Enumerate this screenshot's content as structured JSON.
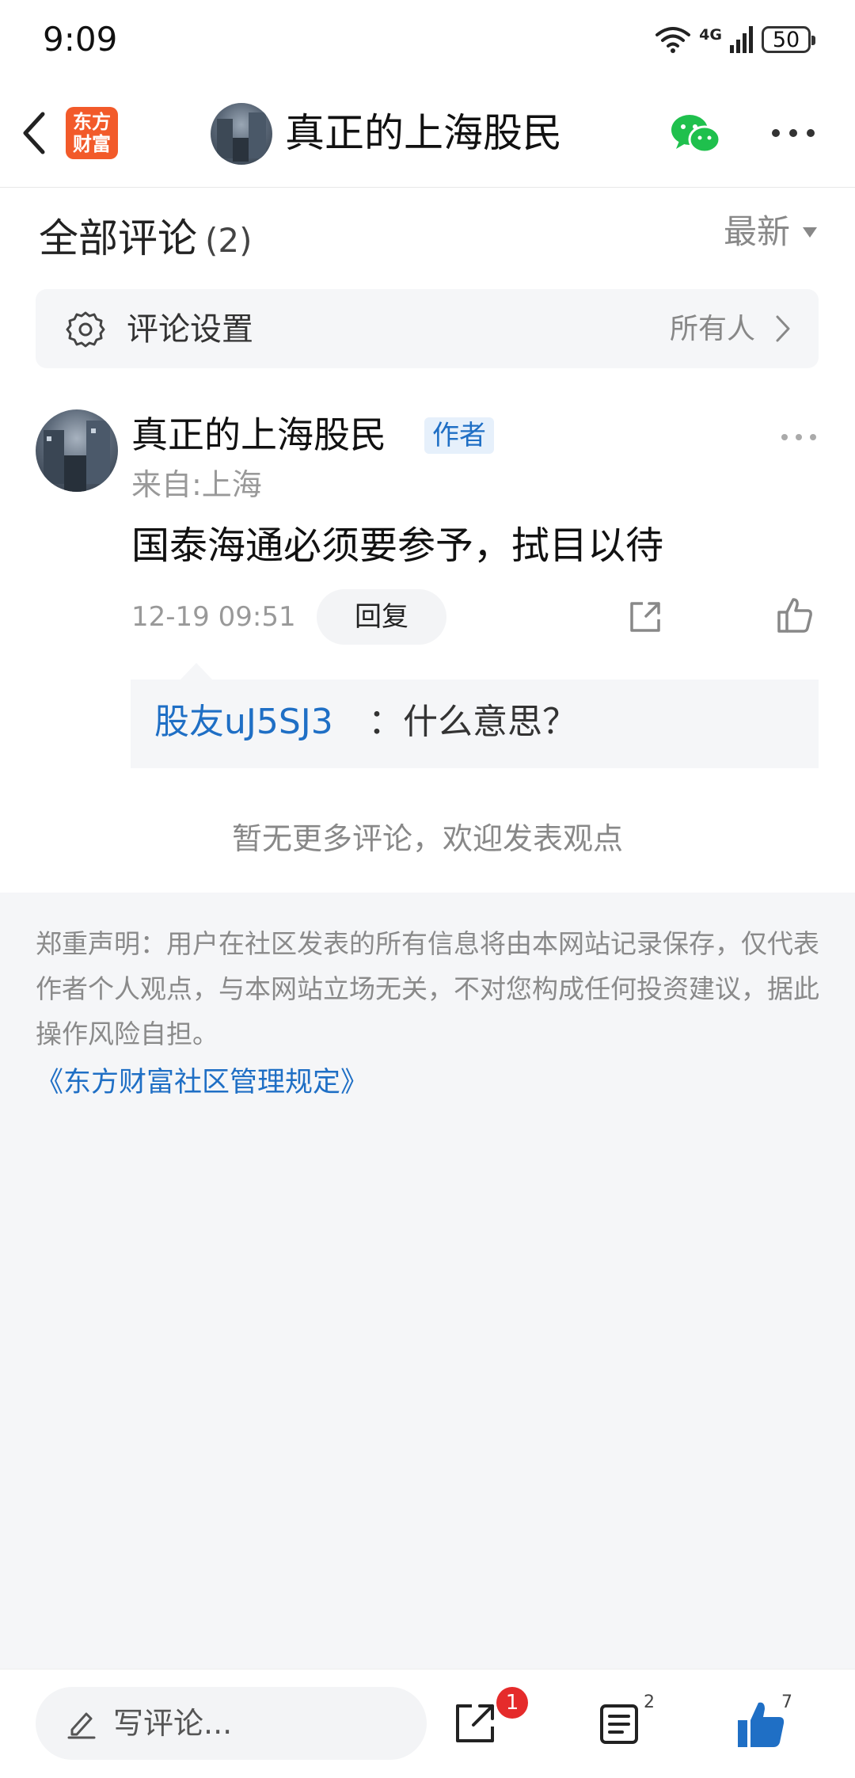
{
  "status_bar": {
    "time": "9:09",
    "network": "4G",
    "battery": "50"
  },
  "header": {
    "logo_line1": "东方",
    "logo_line2": "财富",
    "title": "真正的上海股民",
    "icons": [
      "back-icon",
      "wechat-icon",
      "more-icon"
    ],
    "brand_color": "#f25a2a",
    "wechat_color": "#1fc04d"
  },
  "comments_section": {
    "title": "全部评论",
    "count": "(2)",
    "sort_label": "最新",
    "settings_label": "评论设置",
    "settings_value": "所有人",
    "no_more_text": "暂无更多评论，欢迎发表观点"
  },
  "comment": {
    "author": "真正的上海股民",
    "badge": "作者",
    "location": "来自:上海",
    "text": "国泰海通必须要参予，拭目以待",
    "time": "12-19 09:51",
    "reply_label": "回复",
    "reply": {
      "user": "股友uJ5SJ3",
      "text": "：什么意思？"
    }
  },
  "disclaimer": {
    "text": "郑重声明：用户在社区发表的所有信息将由本网站记录保存，仅代表作者个人观点，与本网站立场无关，不对您构成任何投资建议，据此操作风险自担。",
    "link": "《东方财富社区管理规定》"
  },
  "bottom_bar": {
    "write_placeholder": "写评论...",
    "share_badge": "1",
    "comment_count": "2",
    "like_count": "7",
    "accent": "#1f6fc5"
  }
}
